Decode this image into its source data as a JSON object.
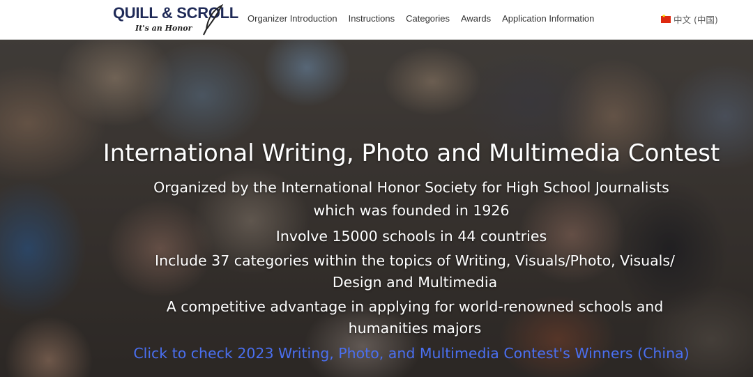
{
  "header": {
    "logo": {
      "main": "QUILL & SCROLL",
      "tagline": "It's an Honor"
    },
    "nav": [
      {
        "label": "Organizer Introduction"
      },
      {
        "label": "Instructions"
      },
      {
        "label": "Categories"
      },
      {
        "label": "Awards"
      },
      {
        "label": "Application Information"
      }
    ],
    "language": {
      "flag_icon": "china-flag-icon",
      "label": "中文 (中国)"
    }
  },
  "hero": {
    "title": "International Writing, Photo and Multimedia Contest",
    "lines": [
      "Organized by the International Honor Society for High School Journalists",
      "which was founded in 1926",
      "Involve 15000 schools in 44 countries",
      "Include 37 categories within the topics of Writing, Visuals/Photo, Visuals/ Design and Multimedia",
      "A competitive advantage in applying for world-renowned schools and humanities majors"
    ],
    "link": "Click to check 2023 Writing, Photo, and Multimedia Contest's Winners (China)"
  },
  "colors": {
    "logo_navy": "#1f2a57",
    "nav_text": "#333333",
    "link_blue": "#4a6ff0",
    "hero_text": "#ffffff"
  }
}
